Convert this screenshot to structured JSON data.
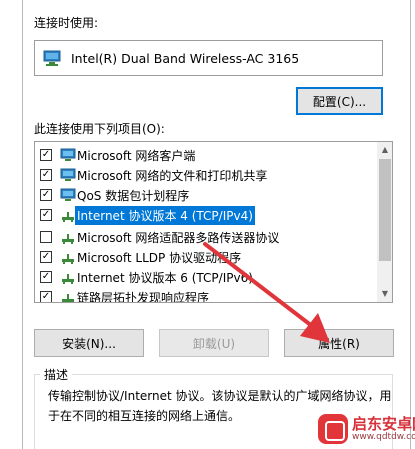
{
  "connection_label": "连接时使用:",
  "adapter_name": "Intel(R) Dual Band Wireless-AC 3165",
  "configure_button": "配置(C)...",
  "items_label": "此连接使用下列项目(O):",
  "items": [
    {
      "label": "Microsoft 网络客户端",
      "checked": true,
      "icon": "network-client-icon"
    },
    {
      "label": "Microsoft 网络的文件和打印机共享",
      "checked": true,
      "icon": "file-printer-sharing-icon"
    },
    {
      "label": "QoS 数据包计划程序",
      "checked": true,
      "icon": "qos-scheduler-icon"
    },
    {
      "label": "Internet 协议版本 4 (TCP/IPv4)",
      "checked": true,
      "selected": true,
      "icon": "protocol-icon"
    },
    {
      "label": "Microsoft 网络适配器多路传送器协议",
      "checked": false,
      "icon": "protocol-icon"
    },
    {
      "label": "Microsoft LLDP 协议驱动程序",
      "checked": true,
      "icon": "protocol-icon"
    },
    {
      "label": "Internet 协议版本 6 (TCP/IPv6)",
      "checked": true,
      "icon": "protocol-icon"
    },
    {
      "label": "链路层拓扑发现响应程序",
      "checked": true,
      "icon": "protocol-icon"
    }
  ],
  "buttons": {
    "install": "安装(N)...",
    "uninstall": "卸载(U)",
    "properties": "属性(R)"
  },
  "description_title": "描述",
  "description_text": "传输控制协议/Internet 协议。该协议是默认的广域网络协议，用于在不同的相互连接的网络上通信。",
  "watermark": {
    "title": "启东安卓网",
    "url": "www.qdtdw.com"
  },
  "colors": {
    "selection": "#0078d7",
    "arrow": "#e0353b",
    "button_bg": "#e4e4e4"
  }
}
